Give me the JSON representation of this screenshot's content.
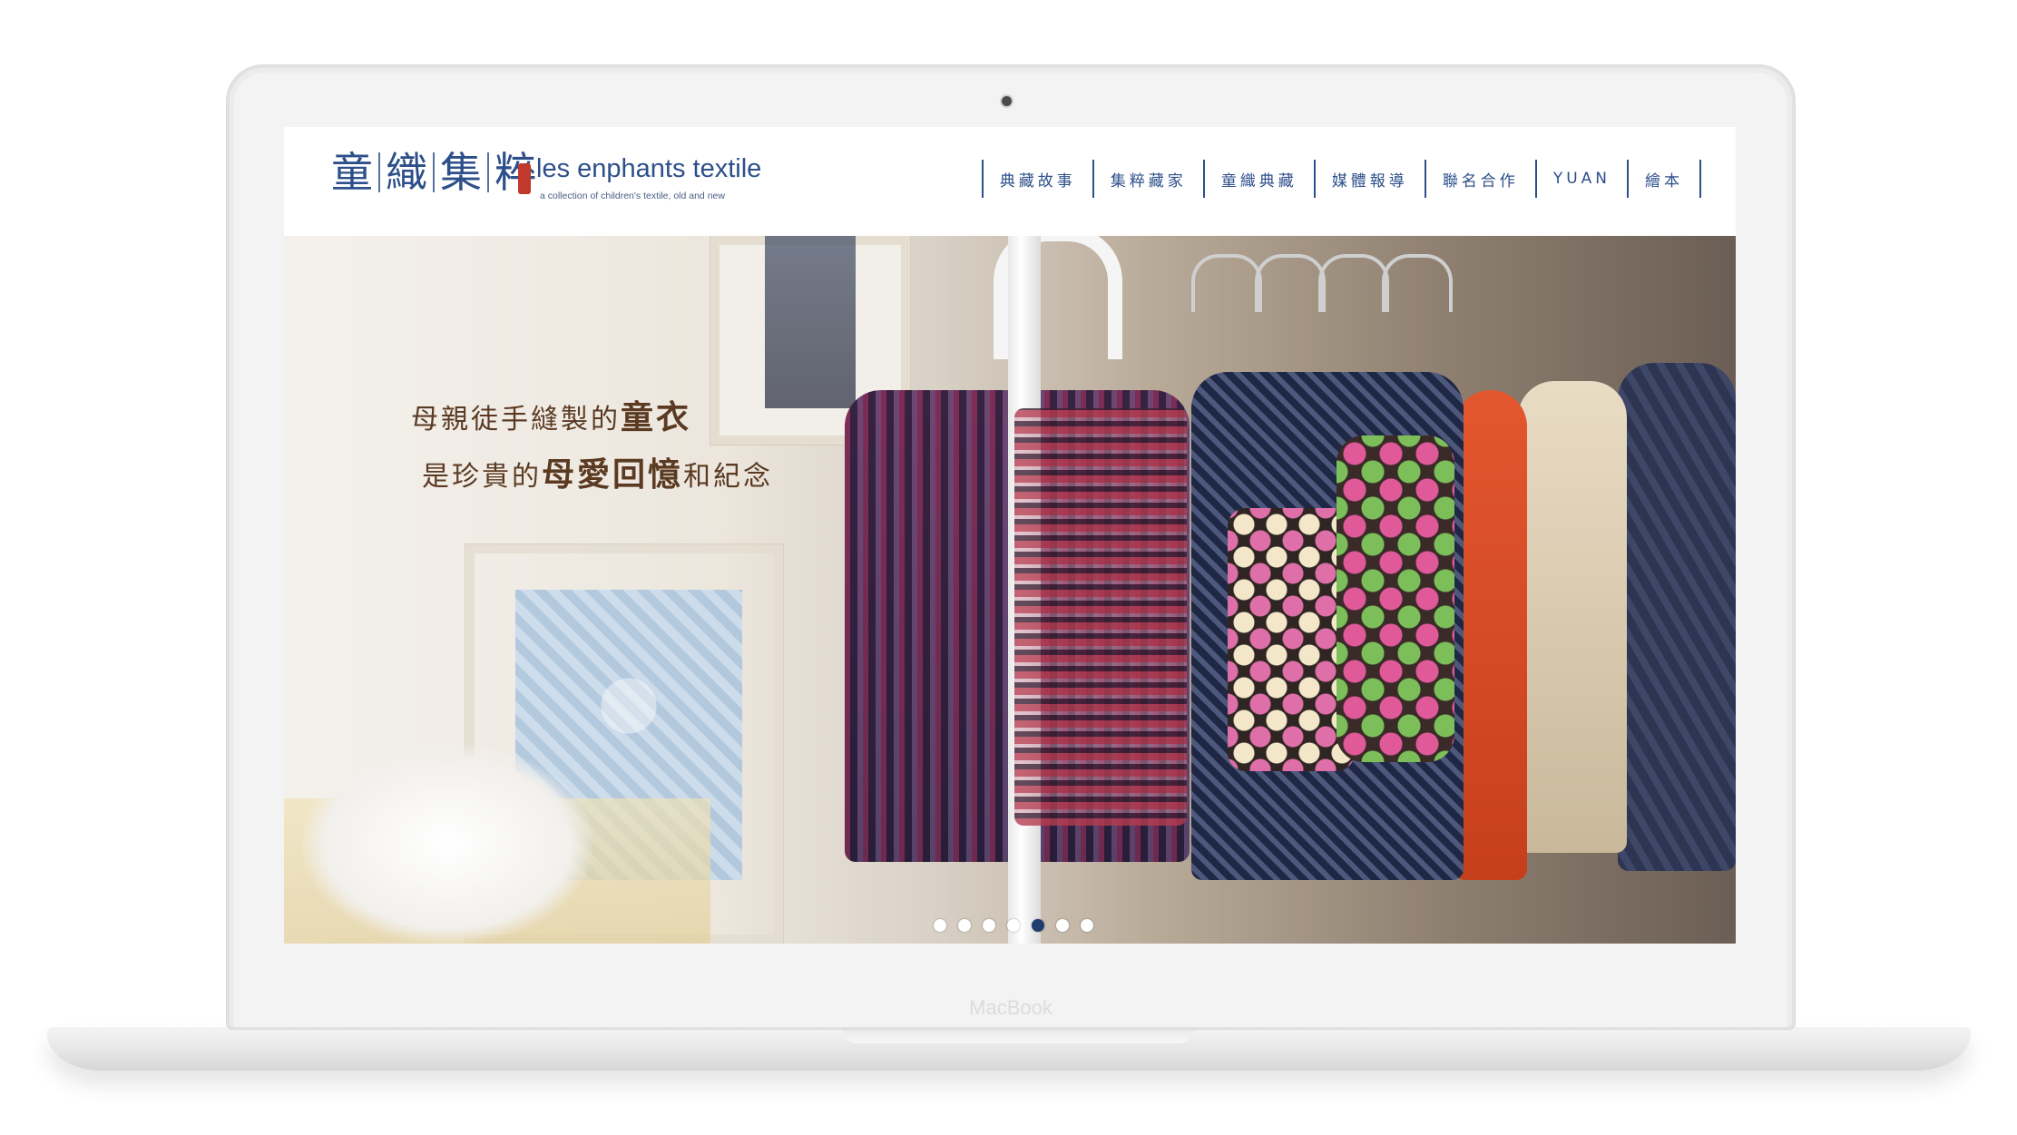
{
  "laptop": {
    "brand_label": "MacBook"
  },
  "logo": {
    "chars": [
      "童",
      "織",
      "集",
      "粹"
    ],
    "seal_text": "王少月",
    "english_name": "les enphants textile",
    "tagline": "a collection of children's textile, old and new"
  },
  "nav": {
    "items": [
      {
        "label": "典藏故事"
      },
      {
        "label": "集粹藏家"
      },
      {
        "label": "童織典藏"
      },
      {
        "label": "媒體報導"
      },
      {
        "label": "聯名合作"
      },
      {
        "label": "YUAN"
      },
      {
        "label": "繪本"
      }
    ]
  },
  "hero": {
    "line1_a": "母親徒手縫製的",
    "line1_b": "童衣",
    "line2_a": "是珍貴的",
    "line2_b": "母愛回憶",
    "line2_c": "和紀念",
    "slides_total": 7,
    "active_slide": 5
  },
  "colors": {
    "brand_blue": "#2d4f8a",
    "hero_text": "#5b3a22",
    "seal_red": "#c0392b",
    "dot_active": "#1f3e6e"
  }
}
